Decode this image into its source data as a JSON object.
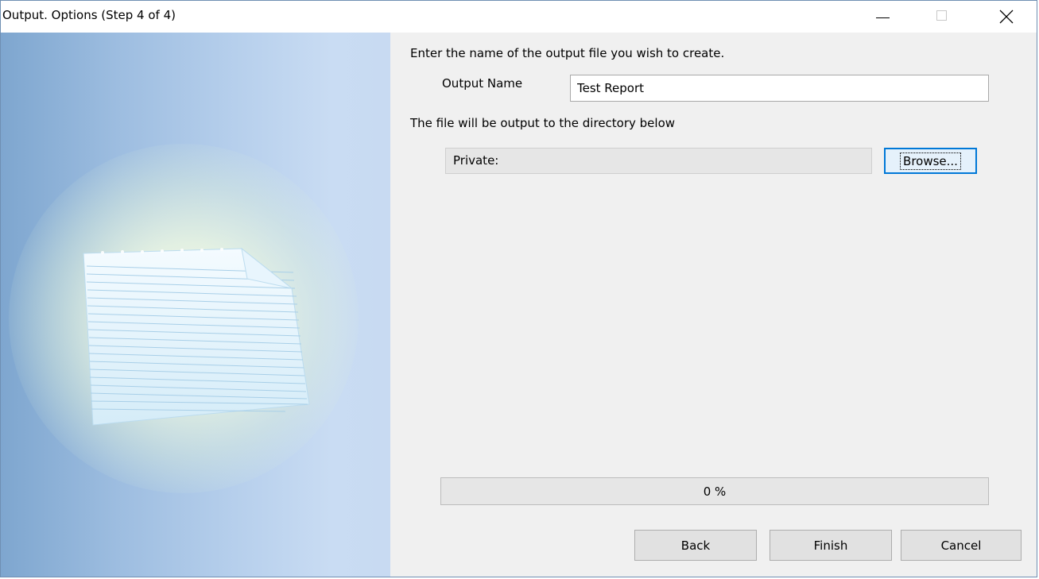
{
  "window": {
    "title": "Output.  Options (Step 4 of 4)"
  },
  "form": {
    "intro": "Enter the name of the output file you wish to create.",
    "output_name_label": "Output Name",
    "output_name_value": "Test Report",
    "directory_label": "The file will be output to the directory below",
    "directory_value": "Private:",
    "browse_label": "Browse..."
  },
  "progress": {
    "value_percent": 0,
    "label": "0 %"
  },
  "buttons": {
    "back": "Back",
    "finish": "Finish",
    "cancel": "Cancel"
  },
  "icons": {
    "minimize": "minimize-icon",
    "maximize": "maximize-icon",
    "close": "close-icon",
    "illustration": "document-illustration"
  },
  "colors": {
    "focus_border": "#0078d7",
    "dialog_background": "#f0f0f0"
  }
}
